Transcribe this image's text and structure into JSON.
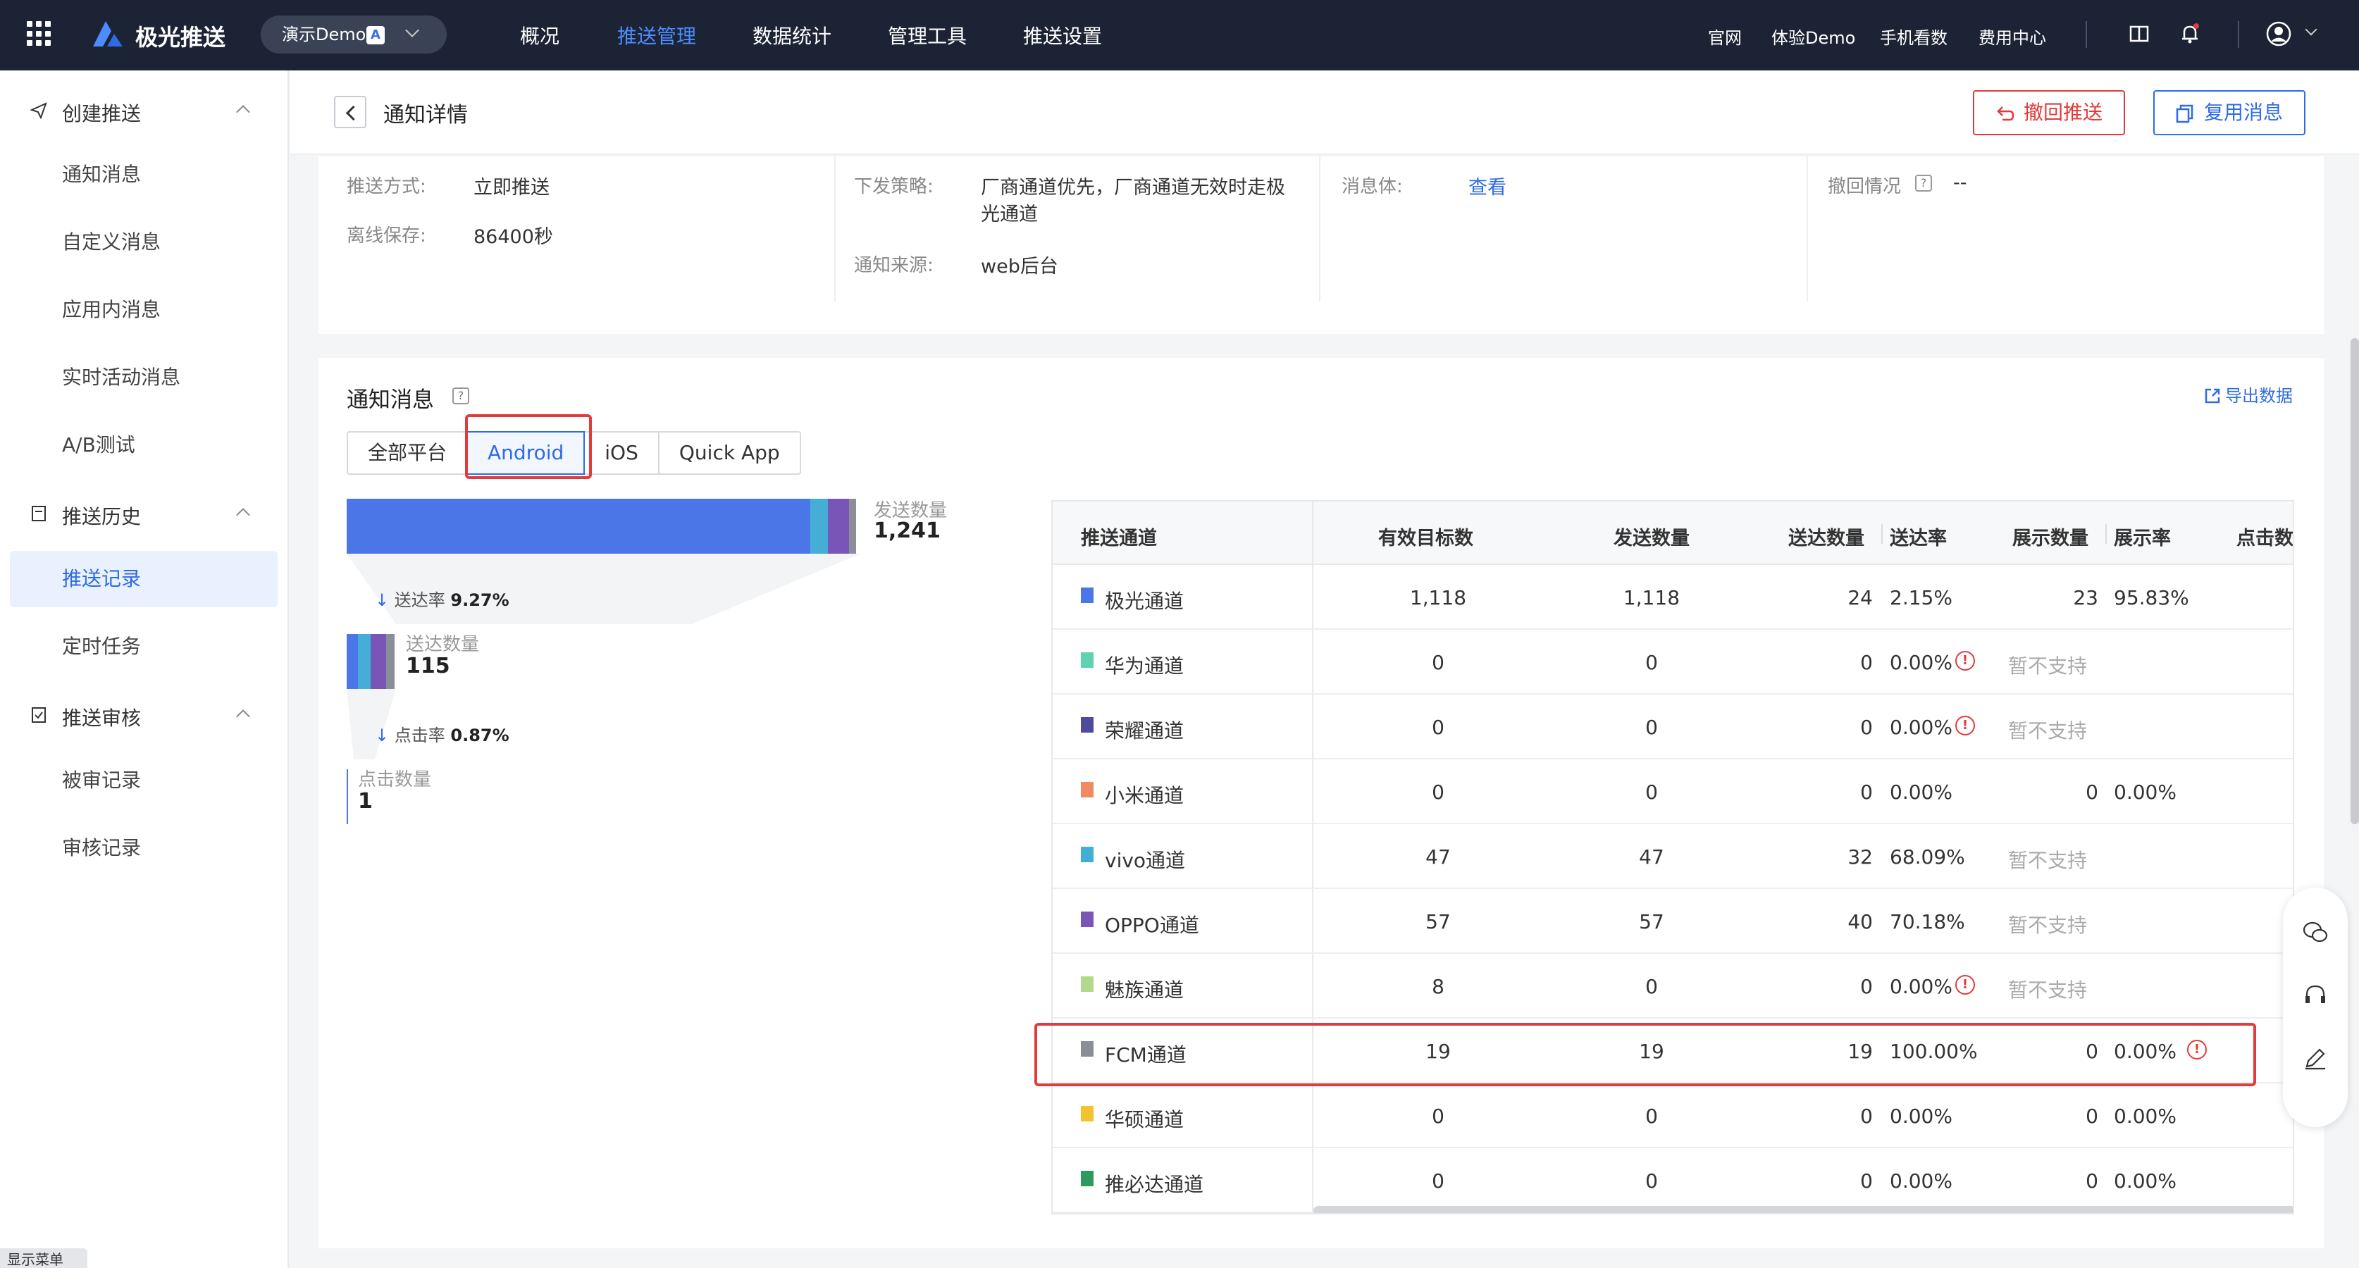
{
  "topbar": {
    "brand": "极光推送",
    "app_select": "演示Demo",
    "app_badge": "A",
    "nav": [
      "概况",
      "推送管理",
      "数据统计",
      "管理工具",
      "推送设置"
    ],
    "nav_active": "推送管理",
    "links": [
      "官网",
      "体验Demo",
      "手机看数",
      "费用中心"
    ]
  },
  "sidebar": {
    "groups": [
      {
        "label": "创建推送",
        "items": [
          "通知消息",
          "自定义消息",
          "应用内消息",
          "实时活动消息",
          "A/B测试"
        ]
      },
      {
        "label": "推送历史",
        "items": [
          "推送记录",
          "定时任务"
        ]
      },
      {
        "label": "推送审核",
        "items": [
          "被审记录",
          "审核记录"
        ]
      }
    ],
    "active_item": "推送记录",
    "show_menu": "显示菜单"
  },
  "header": {
    "title": "通知详情",
    "recall_button": "撤回推送",
    "reuse_button": "复用消息"
  },
  "info": {
    "push_method_label": "推送方式:",
    "push_method_value": "立即推送",
    "offline_label": "离线保存:",
    "offline_value": "86400秒",
    "strategy_label": "下发策略:",
    "strategy_value_line1": "厂商通道优先，厂商通道无效时走极",
    "strategy_value_line2": "光通道",
    "source_label": "通知来源:",
    "source_value": "web后台",
    "body_label": "消息体:",
    "body_link": "查看",
    "recall_label": "撤回情况",
    "recall_value": "--"
  },
  "stats": {
    "title": "通知消息",
    "export": "导出数据",
    "tabs": [
      "全部平台",
      "Android",
      "iOS",
      "Quick App"
    ],
    "active_tab": "Android",
    "funnel": {
      "sent_label": "发送数量",
      "sent_value": "1,241",
      "delivery_rate_label": "送达率",
      "delivery_rate_value": "9.27%",
      "delivered_label": "送达数量",
      "delivered_value": "115",
      "click_rate_label": "点击率",
      "click_rate_value": "0.87%",
      "click_label": "点击数量",
      "click_value": "1"
    },
    "table": {
      "headers": [
        "推送通道",
        "有效目标数",
        "发送数量",
        "送达数量",
        "送达率",
        "展示数量",
        "展示率",
        "点击数"
      ],
      "rows": [
        {
          "name": "极光通道",
          "color": "#4a76e8",
          "target": "1,118",
          "sent": "1,118",
          "delivered": "24",
          "rate": "2.15%",
          "rate_warn": false,
          "shown": "23",
          "show_rate": "95.83%",
          "unsupported": "",
          "show_warn": false
        },
        {
          "name": "华为通道",
          "color": "#5fd3b0",
          "target": "0",
          "sent": "0",
          "delivered": "0",
          "rate": "0.00%",
          "rate_warn": true,
          "shown": "",
          "show_rate": "",
          "unsupported": "暂不支持",
          "show_warn": false
        },
        {
          "name": "荣耀通道",
          "color": "#4e4b9e",
          "target": "0",
          "sent": "0",
          "delivered": "0",
          "rate": "0.00%",
          "rate_warn": true,
          "shown": "",
          "show_rate": "",
          "unsupported": "暂不支持",
          "show_warn": false
        },
        {
          "name": "小米通道",
          "color": "#ef8a62",
          "target": "0",
          "sent": "0",
          "delivered": "0",
          "rate": "0.00%",
          "rate_warn": false,
          "shown": "0",
          "show_rate": "0.00%",
          "unsupported": "",
          "show_warn": false
        },
        {
          "name": "vivo通道",
          "color": "#44aed6",
          "target": "47",
          "sent": "47",
          "delivered": "32",
          "rate": "68.09%",
          "rate_warn": false,
          "shown": "",
          "show_rate": "",
          "unsupported": "暂不支持",
          "show_warn": false
        },
        {
          "name": "OPPO通道",
          "color": "#7a55b8",
          "target": "57",
          "sent": "57",
          "delivered": "40",
          "rate": "70.18%",
          "rate_warn": false,
          "shown": "",
          "show_rate": "",
          "unsupported": "暂不支持",
          "show_warn": false
        },
        {
          "name": "魅族通道",
          "color": "#b3d98a",
          "target": "8",
          "sent": "0",
          "delivered": "0",
          "rate": "0.00%",
          "rate_warn": true,
          "shown": "",
          "show_rate": "",
          "unsupported": "暂不支持",
          "show_warn": false
        },
        {
          "name": "FCM通道",
          "color": "#8b8d99",
          "target": "19",
          "sent": "19",
          "delivered": "19",
          "rate": "100.00%",
          "rate_warn": false,
          "shown": "0",
          "show_rate": "0.00%",
          "unsupported": "",
          "show_warn": true
        },
        {
          "name": "华硕通道",
          "color": "#f2c230",
          "target": "0",
          "sent": "0",
          "delivered": "0",
          "rate": "0.00%",
          "rate_warn": false,
          "shown": "0",
          "show_rate": "0.00%",
          "unsupported": "",
          "show_warn": false
        },
        {
          "name": "推必达通道",
          "color": "#2e9a5e",
          "target": "0",
          "sent": "0",
          "delivered": "0",
          "rate": "0.00%",
          "rate_warn": false,
          "shown": "0",
          "show_rate": "0.00%",
          "unsupported": "",
          "show_warn": false
        }
      ]
    }
  }
}
